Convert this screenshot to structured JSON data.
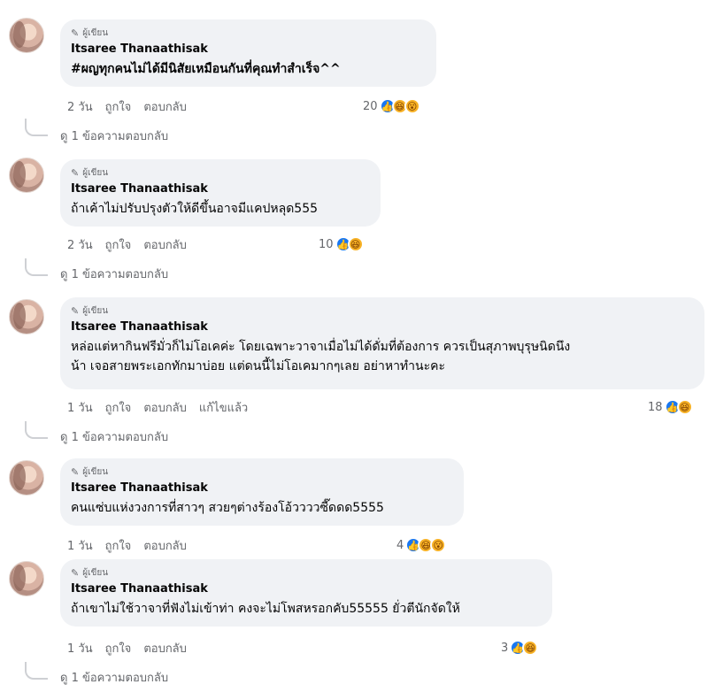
{
  "author_badge": "ผู้เขียน",
  "actions": {
    "like": "ถูกใจ",
    "reply": "ตอบกลับ",
    "edited": "แก้ไขแล้ว"
  },
  "comments": [
    {
      "name": "Itsaree Thanaathisak",
      "text": "#ผญทุกคนไม่ได้มีนิสัยเหมือนกันที่คุณทำสำเร็จ^^",
      "time": "2 วัน",
      "reaction_count": "20",
      "reactions": [
        "like-icon",
        "haha-icon",
        "wow-icon"
      ],
      "reply_label": "ดู 1 ข้อความตอบกลับ"
    },
    {
      "name": "Itsaree Thanaathisak",
      "text": "ถ้าเค้าไม่ปรับปรุงตัวให้ดีขึ้นอาจมีแคปหลุด555",
      "time": "2 วัน",
      "reaction_count": "10",
      "reactions": [
        "like-icon",
        "haha-icon"
      ],
      "reply_label": "ดู 1 ข้อความตอบกลับ"
    },
    {
      "name": "Itsaree Thanaathisak",
      "text": "หล่อแต่หากินฟรีมั่วก็ไม่โอเคค่ะ โดยเฉพาะวาจาเมื่อไม่ได้ดั่มที่ต้องการ ควรเป็นสุภาพบุรุษนิดนึง\nน้า เจอสายพระเอกทักมาบ่อย แต่ดนนี้ไม่โอเคมากๆเลย อย่าหาทำนะคะ",
      "time": "1 วัน",
      "reaction_count": "18",
      "reactions": [
        "like-icon",
        "haha-icon"
      ],
      "reply_label": "ดู 1 ข้อความตอบกลับ"
    },
    {
      "name": "Itsaree Thanaathisak",
      "text": "คนแซ่บแห่งวงการที่สาวๆ สวยๆต่างร้องโอ้ววววซี๊ดดด5555",
      "time": "1 วัน",
      "reaction_count": "4",
      "reactions": [
        "like-icon",
        "haha-icon",
        "wow-icon"
      ],
      "reply_label": ""
    },
    {
      "name": "Itsaree Thanaathisak",
      "text": "ถ้าเขาไม่ใช้วาจาที่ฟังไม่เข้าท่า คงจะไม่โพสหรอกคับ55555 ยั่วตีนักจัดให้",
      "time": "1 วัน",
      "reaction_count": "3",
      "reactions": [
        "like-icon",
        "haha-icon"
      ],
      "reply_label": "ดู 1 ข้อความตอบกลับ"
    }
  ]
}
